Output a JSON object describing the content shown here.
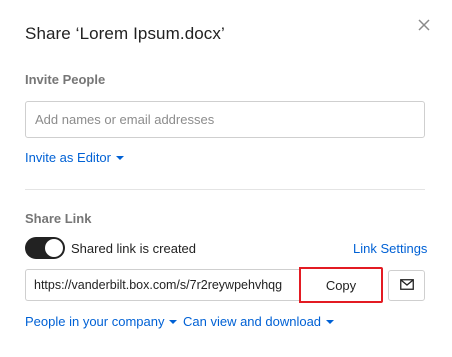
{
  "dialog": {
    "title": "Share ‘Lorem Ipsum.docx’",
    "close_icon": "close-icon"
  },
  "invite": {
    "section_label": "Invite People",
    "input_placeholder": "Add names or email addresses",
    "input_value": "",
    "role_dropdown_label": "Invite as Editor"
  },
  "share_link": {
    "section_label": "Share Link",
    "toggle_on": true,
    "toggle_label": "Shared link is created",
    "settings_link_label": "Link Settings",
    "url": "https://vanderbilt.box.com/s/7r2reywpehvhqg",
    "copy_button_label": "Copy",
    "email_icon": "envelope-icon",
    "access_dropdown_label": "People in your company",
    "permission_dropdown_label": "Can view and download"
  },
  "colors": {
    "accent": "#0061d5",
    "toggle_on": "#222222",
    "highlight": "#e31b23",
    "section_label": "#767676"
  }
}
